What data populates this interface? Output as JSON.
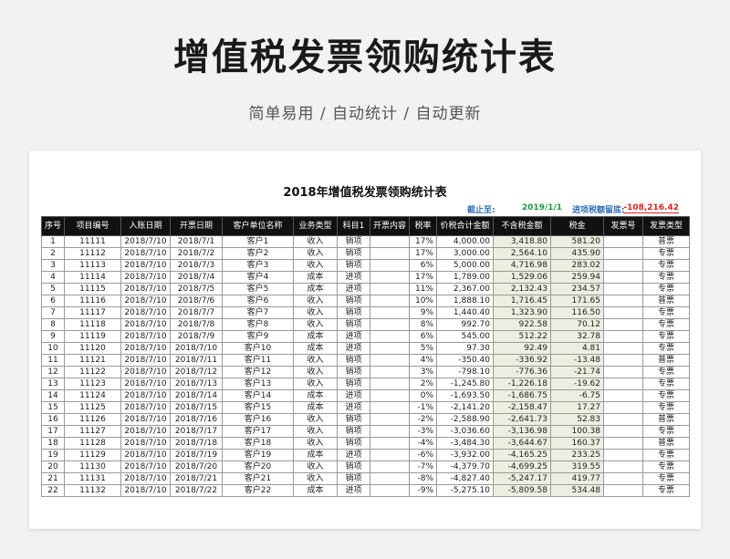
{
  "page": {
    "title": "增值税发票领购统计表",
    "subtitle": "简单易用 / 自动统计 / 自动更新"
  },
  "sheet": {
    "title": "2018年增值税发票领购统计表",
    "cutoff_label": "截止至:",
    "cutoff_date": "2019/1/1",
    "balance_label": "进项税额留底:",
    "balance_value": "-108,216.42",
    "colors": {
      "header_bg": "#111111",
      "label_blue": "#2f6fb5",
      "date_green": "#1f9a3f",
      "value_red": "#e02020",
      "shade": "#ecefe0"
    }
  },
  "table": {
    "headers": [
      "序号",
      "项目编号",
      "入账日期",
      "开票日期",
      "客户单位名称",
      "业务类型",
      "科目1",
      "开票内容",
      "税率",
      "价税合计金额",
      "不含税金额",
      "税金",
      "发票号",
      "发票类型"
    ],
    "rows": [
      [
        "1",
        "11111",
        "2018/7/10",
        "2018/7/1",
        "客户1",
        "收入",
        "销项",
        "",
        "17%",
        "4,000.00",
        "3,418.80",
        "581.20",
        "",
        "普票"
      ],
      [
        "2",
        "11112",
        "2018/7/10",
        "2018/7/2",
        "客户2",
        "收入",
        "销项",
        "",
        "17%",
        "3,000.00",
        "2,564.10",
        "435.90",
        "",
        "专票"
      ],
      [
        "3",
        "11113",
        "2018/7/10",
        "2018/7/3",
        "客户3",
        "收入",
        "销项",
        "",
        "6%",
        "5,000.00",
        "4,716.98",
        "283.02",
        "",
        "专票"
      ],
      [
        "4",
        "11114",
        "2018/7/10",
        "2018/7/4",
        "客户4",
        "成本",
        "进项",
        "",
        "17%",
        "1,789.00",
        "1,529.06",
        "259.94",
        "",
        "专票"
      ],
      [
        "5",
        "11115",
        "2018/7/10",
        "2018/7/5",
        "客户5",
        "成本",
        "进项",
        "",
        "11%",
        "2,367.00",
        "2,132.43",
        "234.57",
        "",
        "专票"
      ],
      [
        "6",
        "11116",
        "2018/7/10",
        "2018/7/6",
        "客户6",
        "收入",
        "销项",
        "",
        "10%",
        "1,888.10",
        "1,716.45",
        "171.65",
        "",
        "普票"
      ],
      [
        "7",
        "11117",
        "2018/7/10",
        "2018/7/7",
        "客户7",
        "收入",
        "销项",
        "",
        "9%",
        "1,440.40",
        "1,323.90",
        "116.50",
        "",
        "专票"
      ],
      [
        "8",
        "11118",
        "2018/7/10",
        "2018/7/8",
        "客户8",
        "收入",
        "销项",
        "",
        "8%",
        "992.70",
        "922.58",
        "70.12",
        "",
        "专票"
      ],
      [
        "9",
        "11119",
        "2018/7/10",
        "2018/7/9",
        "客户9",
        "成本",
        "进项",
        "",
        "6%",
        "545.00",
        "512.22",
        "32.78",
        "",
        "专票"
      ],
      [
        "10",
        "11120",
        "2018/7/10",
        "2018/7/10",
        "客户10",
        "成本",
        "进项",
        "",
        "5%",
        "97.30",
        "92.49",
        "4.81",
        "",
        "专票"
      ],
      [
        "11",
        "11121",
        "2018/7/10",
        "2018/7/11",
        "客户11",
        "收入",
        "销项",
        "",
        "4%",
        "-350.40",
        "-336.92",
        "-13.48",
        "",
        "普票"
      ],
      [
        "12",
        "11122",
        "2018/7/10",
        "2018/7/12",
        "客户12",
        "收入",
        "销项",
        "",
        "3%",
        "-798.10",
        "-776.36",
        "-21.74",
        "",
        "专票"
      ],
      [
        "13",
        "11123",
        "2018/7/10",
        "2018/7/13",
        "客户13",
        "收入",
        "销项",
        "",
        "2%",
        "-1,245.80",
        "-1,226.18",
        "-19.62",
        "",
        "专票"
      ],
      [
        "14",
        "11124",
        "2018/7/10",
        "2018/7/14",
        "客户14",
        "成本",
        "进项",
        "",
        "0%",
        "-1,693.50",
        "-1,686.75",
        "-6.75",
        "",
        "专票"
      ],
      [
        "15",
        "11125",
        "2018/7/10",
        "2018/7/15",
        "客户15",
        "成本",
        "进项",
        "",
        "-1%",
        "-2,141.20",
        "-2,158.47",
        "17.27",
        "",
        "专票"
      ],
      [
        "16",
        "11126",
        "2018/7/10",
        "2018/7/16",
        "客户16",
        "收入",
        "销项",
        "",
        "-2%",
        "-2,588.90",
        "-2,641.73",
        "52.83",
        "",
        "普票"
      ],
      [
        "17",
        "11127",
        "2018/7/10",
        "2018/7/17",
        "客户17",
        "收入",
        "销项",
        "",
        "-3%",
        "-3,036.60",
        "-3,136.98",
        "100.38",
        "",
        "专票"
      ],
      [
        "18",
        "11128",
        "2018/7/10",
        "2018/7/18",
        "客户18",
        "收入",
        "销项",
        "",
        "-4%",
        "-3,484.30",
        "-3,644.67",
        "160.37",
        "",
        "普票"
      ],
      [
        "19",
        "11129",
        "2018/7/10",
        "2018/7/19",
        "客户19",
        "成本",
        "进项",
        "",
        "-6%",
        "-3,932.00",
        "-4,165.25",
        "233.25",
        "",
        "专票"
      ],
      [
        "20",
        "11130",
        "2018/7/10",
        "2018/7/20",
        "客户20",
        "收入",
        "销项",
        "",
        "-7%",
        "-4,379.70",
        "-4,699.25",
        "319.55",
        "",
        "专票"
      ],
      [
        "21",
        "11131",
        "2018/7/10",
        "2018/7/21",
        "客户21",
        "收入",
        "销项",
        "",
        "-8%",
        "-4,827.40",
        "-5,247.17",
        "419.77",
        "",
        "专票"
      ],
      [
        "22",
        "11132",
        "2018/7/10",
        "2018/7/22",
        "客户22",
        "成本",
        "进项",
        "",
        "-9%",
        "-5,275.10",
        "-5,809.58",
        "534.48",
        "",
        "专票"
      ]
    ]
  }
}
